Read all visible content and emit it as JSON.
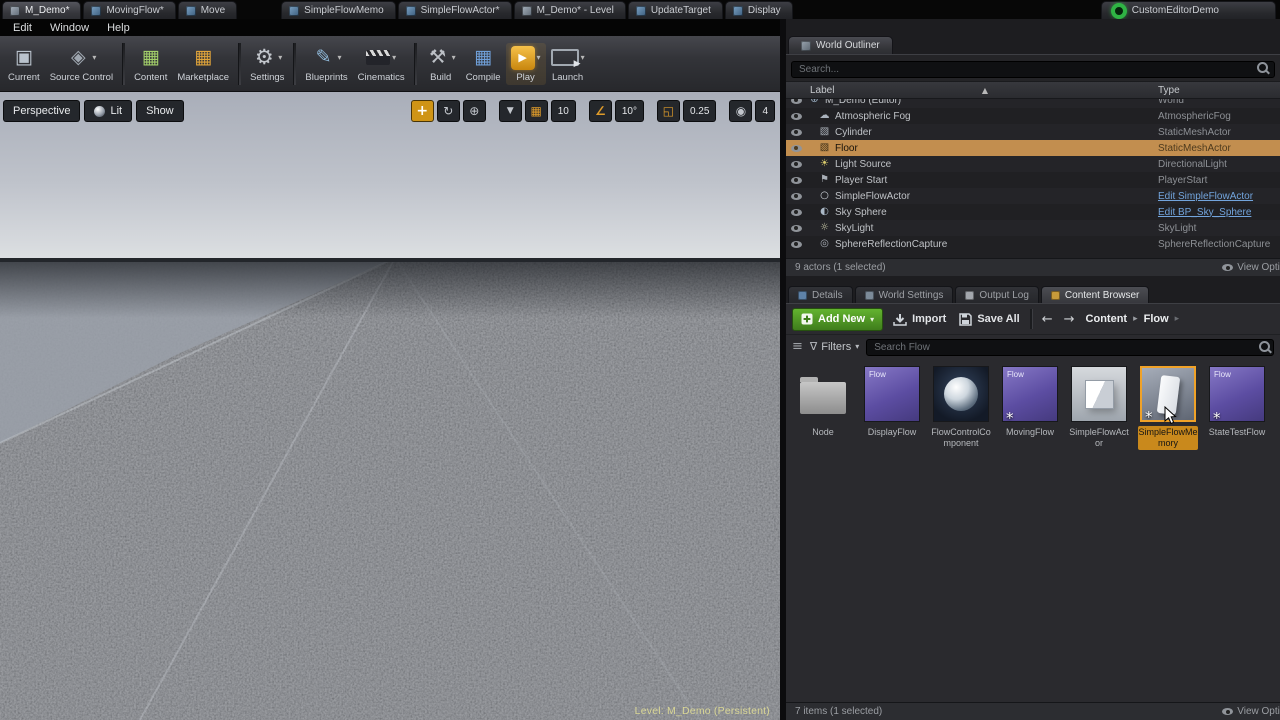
{
  "colors": {
    "accent_orange": "#F0A228",
    "selection_tan": "#C28E4F",
    "play_gold": "#D9A125",
    "add_new_green": "#4C8C27",
    "link_blue": "#72A4DC",
    "flow_purple": "#5C4DA2"
  },
  "tabbar": {
    "tabs": [
      {
        "label": "M_Demo*",
        "icon": "level-tab-icon",
        "active": true
      },
      {
        "label": "MovingFlow*",
        "icon": "blueprint-tab-icon"
      },
      {
        "label": "Move",
        "icon": "blueprint-tab-icon"
      },
      {
        "label": "SimpleFlowMemo",
        "icon": "blueprint-tab-icon",
        "gap_before": true
      },
      {
        "label": "SimpleFlowActor*",
        "icon": "blueprint-tab-icon"
      },
      {
        "label": "M_Demo* - Level",
        "icon": "level-tab-icon"
      },
      {
        "label": "UpdateTarget",
        "icon": "blueprint-tab-icon"
      },
      {
        "label": "Display",
        "icon": "blueprint-tab-icon"
      },
      {
        "label": "CustomEditorDemo",
        "icon": "custom-editor-green-icon",
        "right": true
      }
    ]
  },
  "menubar": {
    "items": [
      "Edit",
      "Window",
      "Help"
    ]
  },
  "toolbar": {
    "buttons": [
      {
        "label": "Current",
        "icon": "save-current-icon"
      },
      {
        "label": "Source Control",
        "icon": "source-control-icon",
        "dropdown": true,
        "sep_after": true
      },
      {
        "label": "Content",
        "icon": "content-icon"
      },
      {
        "label": "Marketplace",
        "icon": "marketplace-icon",
        "sep_after": true
      },
      {
        "label": "Settings",
        "icon": "settings-icon",
        "dropdown": true,
        "sep_after": true
      },
      {
        "label": "Blueprints",
        "icon": "blueprints-icon",
        "dropdown": true
      },
      {
        "label": "Cinematics",
        "icon": "cinematics-icon",
        "dropdown": true,
        "sep_after": true
      },
      {
        "label": "Build",
        "icon": "build-icon",
        "dropdown": true
      },
      {
        "label": "Compile",
        "icon": "compile-icon"
      },
      {
        "label": "Play",
        "icon": "play-icon",
        "dropdown": true,
        "active": true
      },
      {
        "label": "Launch",
        "icon": "launch-icon",
        "dropdown": true
      }
    ]
  },
  "viewport": {
    "mode_buttons": [
      {
        "label": "Perspective"
      },
      {
        "label": "Lit",
        "icon": "lit-sphere-icon"
      },
      {
        "label": "Show"
      }
    ],
    "snap_controls": [
      {
        "icon": "move-tool-icon",
        "active": true
      },
      {
        "icon": "rotate-tool-icon"
      },
      {
        "icon": "world-coords-icon"
      },
      {
        "gap": true
      },
      {
        "icon": "surface-snap-icon"
      },
      {
        "icon": "grid-snap-icon"
      },
      {
        "chip": "10",
        "name": "grid-snap-value"
      },
      {
        "gap": true
      },
      {
        "icon": "rotation-snap-icon"
      },
      {
        "chip": "10°",
        "name": "rotation-snap-value"
      },
      {
        "gap": true
      },
      {
        "icon": "scale-snap-icon"
      },
      {
        "chip": "0.25",
        "name": "scale-snap-value"
      },
      {
        "gap": true
      },
      {
        "icon": "camera-speed-icon"
      },
      {
        "chip": "4",
        "name": "camera-speed-value"
      }
    ],
    "status": "Level:  M_Demo (Persistent)"
  },
  "outliner": {
    "tab_title": "World Outliner",
    "search_placeholder": "Search...",
    "columns": {
      "label": "Label",
      "type": "Type"
    },
    "rows": [
      {
        "label": "M_Demo (Editor)",
        "type": "World",
        "icon": "world-icon",
        "top_level": true
      },
      {
        "label": "Atmospheric Fog",
        "type": "AtmosphericFog",
        "icon": "fog-icon"
      },
      {
        "label": "Cylinder",
        "type": "StaticMeshActor",
        "icon": "mesh-icon"
      },
      {
        "label": "Floor",
        "type": "StaticMeshActor",
        "icon": "mesh-icon",
        "selected": true
      },
      {
        "label": "Light Source",
        "type": "DirectionalLight",
        "icon": "light-icon"
      },
      {
        "label": "Player Start",
        "type": "PlayerStart",
        "icon": "player-start-icon"
      },
      {
        "label": "SimpleFlowActor",
        "type": "Edit SimpleFlowActor",
        "icon": "actor-icon",
        "type_link": true
      },
      {
        "label": "Sky Sphere",
        "type": "Edit BP_Sky_Sphere",
        "icon": "sphere-actor-icon",
        "type_link": true
      },
      {
        "label": "SkyLight",
        "type": "SkyLight",
        "icon": "skylight-icon"
      },
      {
        "label": "SphereReflectionCapture",
        "type": "SphereReflectionCapture",
        "icon": "reflection-icon"
      }
    ],
    "footer": "9 actors (1 selected)",
    "view_options": "View Options"
  },
  "panel_tabs": [
    {
      "label": "Details",
      "icon": "details-icon"
    },
    {
      "label": "World Settings",
      "icon": "world-settings-icon"
    },
    {
      "label": "Output Log",
      "icon": "output-log-icon"
    },
    {
      "label": "Content Browser",
      "icon": "content-browser-icon",
      "active": true
    }
  ],
  "content_browser": {
    "add_new": "Add New",
    "import": "Import",
    "save_all": "Save All",
    "breadcrumb": [
      "Content",
      "Flow"
    ],
    "filters_label": "Filters",
    "search_placeholder": "Search Flow",
    "assets": [
      {
        "name": "Node",
        "kind": "folder"
      },
      {
        "name": "DisplayFlow",
        "kind": "flow",
        "badge": "Flow"
      },
      {
        "name": "FlowControlComponent",
        "kind": "component"
      },
      {
        "name": "MovingFlow",
        "kind": "flow",
        "badge": "Flow",
        "star": true
      },
      {
        "name": "SimpleFlowActor",
        "kind": "actor"
      },
      {
        "name": "SimpleFlowMemory",
        "kind": "memory",
        "star": true,
        "selected": true
      },
      {
        "name": "StateTestFlow",
        "kind": "flow",
        "badge": "Flow",
        "star": true
      }
    ],
    "footer": "7 items (1 selected)",
    "view_options": "View Options"
  }
}
